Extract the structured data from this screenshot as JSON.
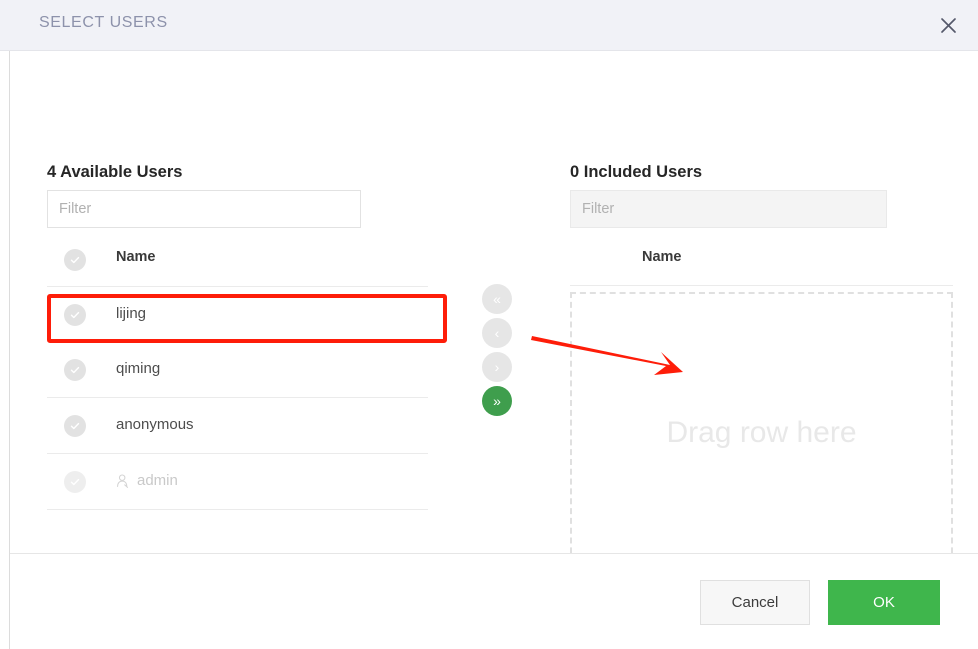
{
  "modal": {
    "title": "SELECT USERS",
    "close_icon": "close-icon"
  },
  "available_panel": {
    "heading": "4 Available Users",
    "filter_placeholder": "Filter",
    "filter_value": "",
    "column_header": "Name",
    "rows": [
      {
        "name": "lijing",
        "disabled": false,
        "has_person_icon": false
      },
      {
        "name": "qiming",
        "disabled": false,
        "has_person_icon": false
      },
      {
        "name": "anonymous",
        "disabled": false,
        "has_person_icon": false
      },
      {
        "name": "admin",
        "disabled": true,
        "has_person_icon": true
      }
    ]
  },
  "transfer": {
    "buttons": [
      {
        "name": "move-all-left-button",
        "glyph": "«",
        "active": false
      },
      {
        "name": "move-left-button",
        "glyph": "‹",
        "active": false
      },
      {
        "name": "move-right-button",
        "glyph": "›",
        "active": false
      },
      {
        "name": "move-all-right-button",
        "glyph": "»",
        "active": true
      }
    ]
  },
  "included_panel": {
    "heading": "0 Included Users",
    "filter_placeholder": "Filter",
    "filter_value": "",
    "column_header": "Name",
    "drop_zone_text": "Drag row here"
  },
  "footer": {
    "cancel_label": "Cancel",
    "ok_label": "OK"
  },
  "colors": {
    "header_bg": "#f1f2f7",
    "title": "#8d92ab",
    "accent_green": "#3fb64c",
    "transfer_green": "#3f9e4d",
    "annotation_red": "#fe1d09",
    "placeholder": "#b1b1b1",
    "drop_text": "#e8e8e8"
  }
}
